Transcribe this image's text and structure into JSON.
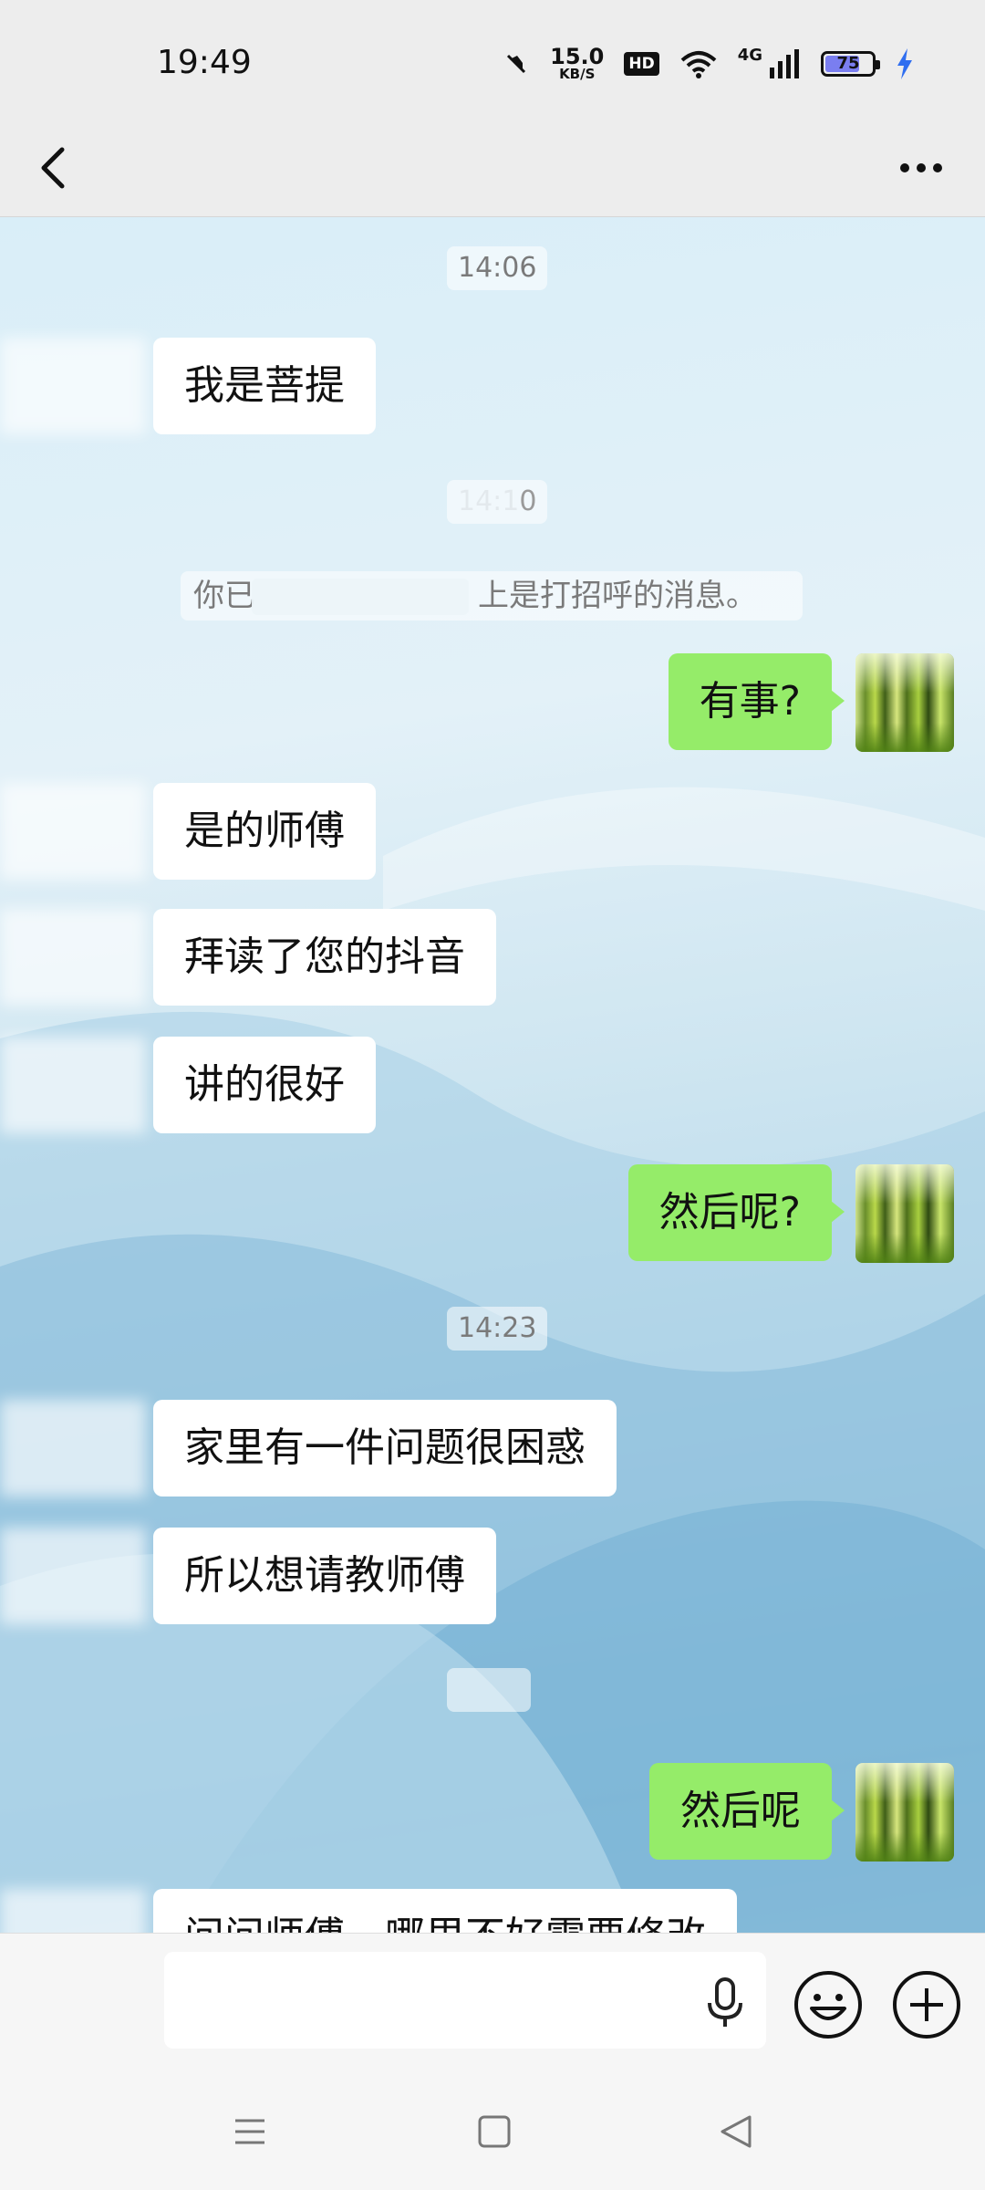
{
  "status_bar": {
    "time": "19:49",
    "net_speed": "15.0",
    "net_speed_unit": "KB/S",
    "hd": "HD",
    "network_type": "4G",
    "battery": "75",
    "battery_level_pct": 75,
    "charging": true
  },
  "header": {
    "back_icon": "chevron-left-icon",
    "more_icon": "more-horizontal-icon"
  },
  "chat": {
    "time_1": "14:06",
    "time_2_blurred": "0",
    "system_notice_start": "你已",
    "system_notice_end": "上是打招呼的消息。",
    "time_3": "14:23",
    "messages": [
      {
        "side": "in",
        "text": "我是菩提"
      },
      {
        "side": "out",
        "text": "有事?"
      },
      {
        "side": "in",
        "text": "是的师傅"
      },
      {
        "side": "in",
        "text": "拜读了您的抖音"
      },
      {
        "side": "in",
        "text": "讲的很好"
      },
      {
        "side": "out",
        "text": "然后呢?"
      },
      {
        "side": "in",
        "text": "家里有一件问题很困惑"
      },
      {
        "side": "in",
        "text": "所以想请教师傅"
      },
      {
        "side": "out",
        "text": "然后呢"
      },
      {
        "side": "in",
        "text": "问问师傅，哪里不好需要修改"
      }
    ]
  },
  "input_bar": {
    "placeholder": "",
    "mic_icon": "microphone-icon",
    "emoji_icon": "smiley-face-icon",
    "plus_icon": "plus-circle-icon"
  },
  "nav_bar": {
    "menu_icon": "menu-icon",
    "home_icon": "square-home-icon",
    "back_icon": "triangle-back-icon"
  },
  "colors": {
    "outgoing_bubble": "#95ec69",
    "incoming_bubble": "#ffffff",
    "background": "#ededed"
  }
}
